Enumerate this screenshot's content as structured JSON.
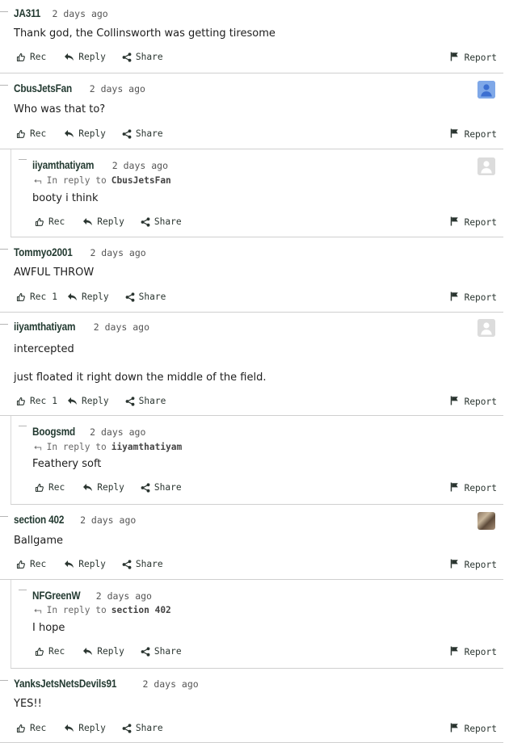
{
  "actions": {
    "rec": "Rec",
    "reply": "Reply",
    "share": "Share",
    "report": "Report",
    "in_reply_to": "In reply to"
  },
  "comments": [
    {
      "user": "JA311",
      "time": "2 days ago",
      "body": [
        "Thank god, the Collinsworth was getting tiresome"
      ],
      "rec_count": "",
      "avatar": "none"
    },
    {
      "user": "CbusJetsFan",
      "time": "2 days ago",
      "body": [
        "Who was that to?"
      ],
      "rec_count": "",
      "avatar": "blue-person"
    },
    {
      "user": "iiyamthatiyam",
      "time": "2 days ago",
      "in_reply_to": "CbusJetsFan",
      "body": [
        "booty i think"
      ],
      "rec_count": "",
      "avatar": "gray-person"
    },
    {
      "user": "Tommyo2001",
      "time": "2 days ago",
      "body": [
        "AWFUL THROW"
      ],
      "rec_count": "1",
      "avatar": "none"
    },
    {
      "user": "iiyamthatiyam",
      "time": "2 days ago",
      "body": [
        "intercepted",
        "just floated it right down the middle of the field."
      ],
      "rec_count": "1",
      "avatar": "gray-person"
    },
    {
      "user": "Boogsmd",
      "time": "2 days ago",
      "in_reply_to": "iiyamthatiyam",
      "body": [
        "Feathery soft"
      ],
      "rec_count": "",
      "avatar": "none"
    },
    {
      "user": "section 402",
      "time": "2 days ago",
      "body": [
        "Ballgame"
      ],
      "rec_count": "",
      "avatar": "photo"
    },
    {
      "user": "NFGreenW",
      "time": "2 days ago",
      "in_reply_to": "section 402",
      "body": [
        "I hope"
      ],
      "rec_count": "",
      "avatar": "none"
    },
    {
      "user": "YanksJetsNetsDevils91",
      "time": "2 days ago",
      "body": [
        "YES!!"
      ],
      "rec_count": "",
      "avatar": "none"
    }
  ]
}
